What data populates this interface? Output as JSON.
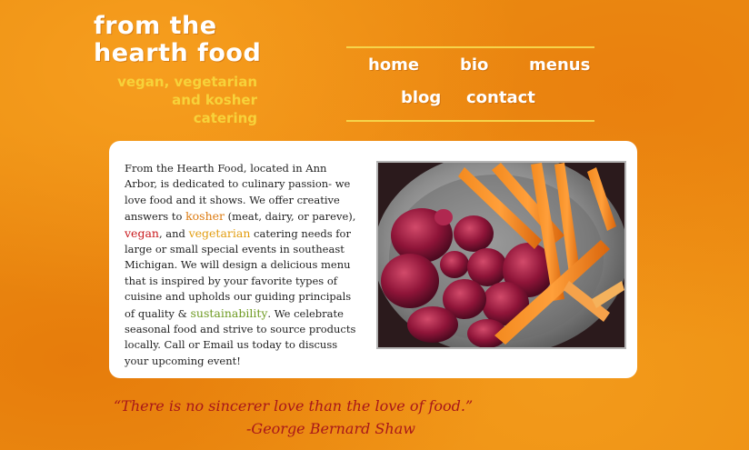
{
  "site": {
    "title_line1": "From the",
    "title_line2": "hearth food",
    "tagline_line1": "vegan, vegetarian",
    "tagline_line2": "and kosher",
    "tagline_line3": "catering"
  },
  "nav": {
    "home": "home",
    "bio": "bio",
    "menus": "menus",
    "blog": "blog",
    "contact": "contact"
  },
  "content": {
    "p1": "From the Hearth Food, located in Ann Arbor, is dedicated to culinary passion- we love food and it shows. We offer creative answers to ",
    "link_kosher": "kosher",
    "p2": " (meat, dairy, or pareve), ",
    "link_vegan": "vegan",
    "p3": ", and ",
    "link_vegetarian": "vegetarian",
    "p4": " catering needs for large or small special events in southeast Michigan. We will design a delicious menu that is inspired by your favorite types of cuisine and upholds our guiding principals of quality & ",
    "link_sustainability": "sustainability",
    "p5": ". We celebrate seasonal food and strive to source products locally. Call or Email us today to discuss your upcoming event!"
  },
  "quote": {
    "text": "“There is no sincerer love than the love of food.”",
    "author": "-George Bernard Shaw"
  },
  "colors": {
    "background": "#ec8f12",
    "title": "#ffffff",
    "tagline": "#f7d23a",
    "rule": "#f6d44a",
    "kosher": "#dc7a0f",
    "vegan": "#c9181c",
    "vegetarian": "#e29d10",
    "sustainability": "#6e9a22",
    "quote": "#a8171a"
  }
}
